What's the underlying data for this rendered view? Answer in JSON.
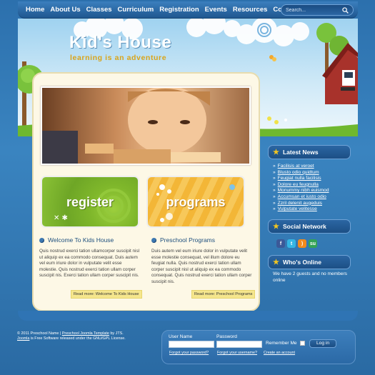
{
  "nav": {
    "items": [
      "Home",
      "About Us",
      "Classes",
      "Curriculum",
      "Registration",
      "Events",
      "Resources",
      "Contact"
    ],
    "search_placeholder": "Search..."
  },
  "header": {
    "title": "Kid's House",
    "tagline": "learning is an adventure"
  },
  "promos": {
    "register_label": "register",
    "programs_label": "programs"
  },
  "articles": [
    {
      "title": "Welcome To Kids House",
      "body": "Quis nostrud exerci tation ullamcorper suscipit nisl ut aliquip ex ea commodo consequat. Duis autem vel eum iriure dolor in vulputate velit esse molestie. Quis nostrud exerci tation ullam corper suscipit nis. Exerci tation ullam corper suscipit nis.",
      "readmore": "Read more: Welcome To Kids House"
    },
    {
      "title": "Preschool Programs",
      "body": "Duis autem vel eum iriure dolor in vulputate velit esse molestie consequat, vel illum dolore eu feugiat nulla. Quis nostrud exerci tation ullam corper suscipit nisl ut aliquip ex ea commodo consequat.  Quis nostrud exerci tation ullam corper suscipit nis.",
      "readmore": "Read more: Preschool Programs"
    }
  ],
  "sidebar": {
    "news_title": "Latest News",
    "news_items": [
      "Facilisis at veroet",
      "Blusto odio quidtum",
      "Feugiat nulla facilisis",
      "Dolore eu feugnulla",
      "Monummy nibh euismod",
      "Accumsan et iusto odio",
      "Zzril delenit augeduis",
      "Vulputate velitesse"
    ],
    "social_title": "Social Network",
    "social_icons": [
      "facebook-icon",
      "twitter-icon",
      "rss-icon",
      "stumbleupon-icon"
    ],
    "online_title": "Who's Online",
    "online_text": "We have 2 guests and no members online"
  },
  "footer": {
    "copyright": "© 2011 Preschool Name |",
    "template_link": "Preschool Joomla Template",
    "by": "by JTS.",
    "joomla_link": "Joomla",
    "license": "is Free Software released under the GNU/GPL License."
  },
  "login": {
    "username_label": "User Name",
    "password_label": "Password",
    "remember_label": "Remember Me",
    "button_label": "Log in",
    "forgot_password": "Forgot your password?",
    "forgot_username": "Forgot your username?",
    "create_account": "Create an account"
  },
  "colors": {
    "page_bg": "#2a6aa3",
    "panel_bg": "#fdf8e6",
    "nav_bg": "#1f5790",
    "accent_green": "#7fb72b",
    "accent_orange": "#f3b637",
    "star_yellow": "#f4c61f"
  }
}
